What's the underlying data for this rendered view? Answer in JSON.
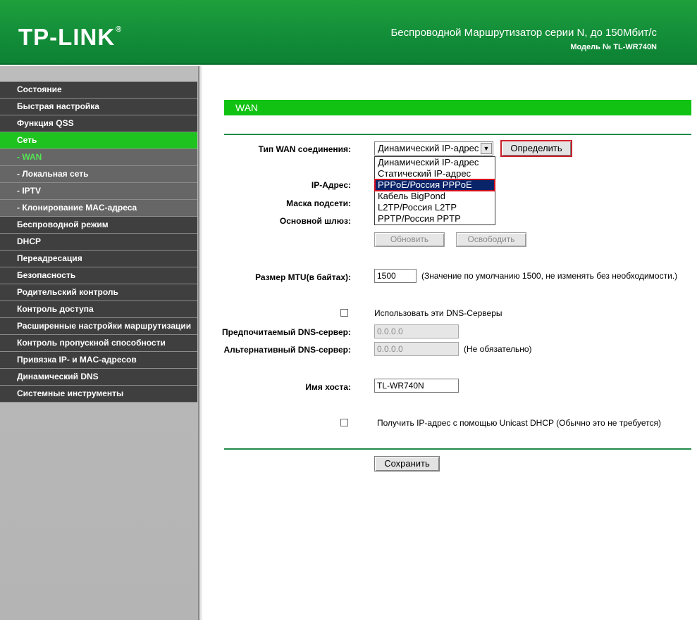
{
  "header": {
    "logo": "TP-LINK",
    "title": "Беспроводной Маршрутизатор серии N, до 150Мбит/с",
    "model": "Модель № TL-WR740N"
  },
  "sidebar": {
    "items": [
      {
        "label": "Состояние"
      },
      {
        "label": "Быстрая настройка"
      },
      {
        "label": "Функция QSS"
      },
      {
        "label": "Сеть"
      },
      {
        "label": "- WAN"
      },
      {
        "label": "- Локальная сеть"
      },
      {
        "label": "- IPTV"
      },
      {
        "label": "- Клонирование MAC-адреса"
      },
      {
        "label": "Беспроводной режим"
      },
      {
        "label": "DHCP"
      },
      {
        "label": "Переадресация"
      },
      {
        "label": "Безопасность"
      },
      {
        "label": "Родительский контроль"
      },
      {
        "label": "Контроль доступа"
      },
      {
        "label": "Расширенные настройки маршрутизации"
      },
      {
        "label": "Контроль пропускной способности"
      },
      {
        "label": "Привязка IP- и MAC-адресов"
      },
      {
        "label": "Динамический DNS"
      },
      {
        "label": "Системные инструменты"
      }
    ]
  },
  "main": {
    "section_title": "WAN",
    "wan_type_label": "Тип WAN соединения:",
    "wan_type_value": "Динамический IP-адрес",
    "wan_type_options": [
      "Динамический IP-адрес",
      "Статический IP-адрес",
      "PPPoE/Россия PPPoE",
      "Кабель BigPond",
      "L2TP/Россия L2TP",
      "PPTP/Россия PPTP"
    ],
    "detect_button": "Определить",
    "ip_label": "IP-Адрес:",
    "mask_label": "Маска подсети:",
    "gateway_label": "Основной шлюз:",
    "renew_button": "Обновить",
    "release_button": "Освободить",
    "mtu_label": "Размер MTU(в байтах):",
    "mtu_value": "1500",
    "mtu_hint": "(Значение по умолчанию 1500, не изменять без необходимости.)",
    "use_dns_label": "Использовать эти DNS-Серверы",
    "primary_dns_label": "Предпочитаемый DNS-сервер:",
    "primary_dns_value": "0.0.0.0",
    "secondary_dns_label": "Альтернативный DNS-сервер:",
    "secondary_dns_value": "0.0.0.0",
    "optional_hint": "(Не обязательно)",
    "hostname_label": "Имя хоста:",
    "hostname_value": "TL-WR740N",
    "unicast_label": "Получить IP-адрес с помощью Unicast DHCP (Обычно это не требуется)",
    "save_button": "Сохранить"
  }
}
